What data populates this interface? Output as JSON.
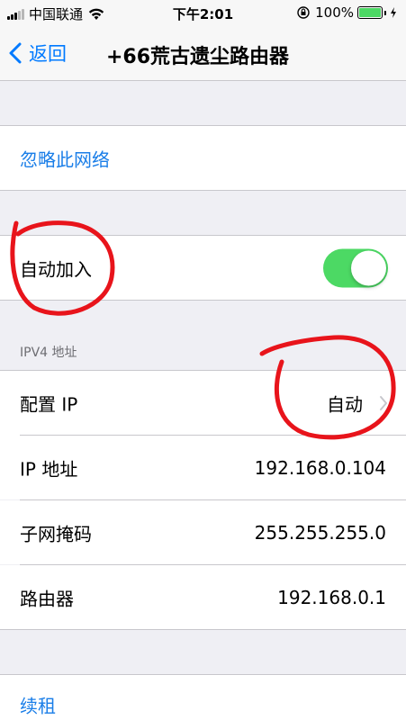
{
  "status_bar": {
    "carrier": "中国联通",
    "time": "下午2:01",
    "battery_percent": "100%",
    "battery_level": 1.0,
    "icons": [
      "signal-icon",
      "wifi-icon",
      "rotation-lock-icon",
      "battery-icon",
      "charging-bolt-icon"
    ]
  },
  "nav": {
    "back_label": "返回",
    "title": "+66荒古遗尘路由器"
  },
  "forget_network": {
    "label": "忽略此网络"
  },
  "auto_join": {
    "label": "自动加入",
    "enabled": true
  },
  "ipv4": {
    "header": "IPV4 地址",
    "rows": [
      {
        "label": "配置 IP",
        "value": "自动"
      },
      {
        "label": "IP 地址",
        "value": "192.168.0.104"
      },
      {
        "label": "子网掩码",
        "value": "255.255.255.0"
      },
      {
        "label": "路由器",
        "value": "192.168.0.1"
      }
    ]
  },
  "renew_lease": {
    "label": "续租"
  },
  "colors": {
    "accent": "#007aff",
    "link": "#1a7ee8",
    "toggle_on": "#4cd964",
    "annotation": "#e8141b",
    "background": "#efeff4"
  }
}
